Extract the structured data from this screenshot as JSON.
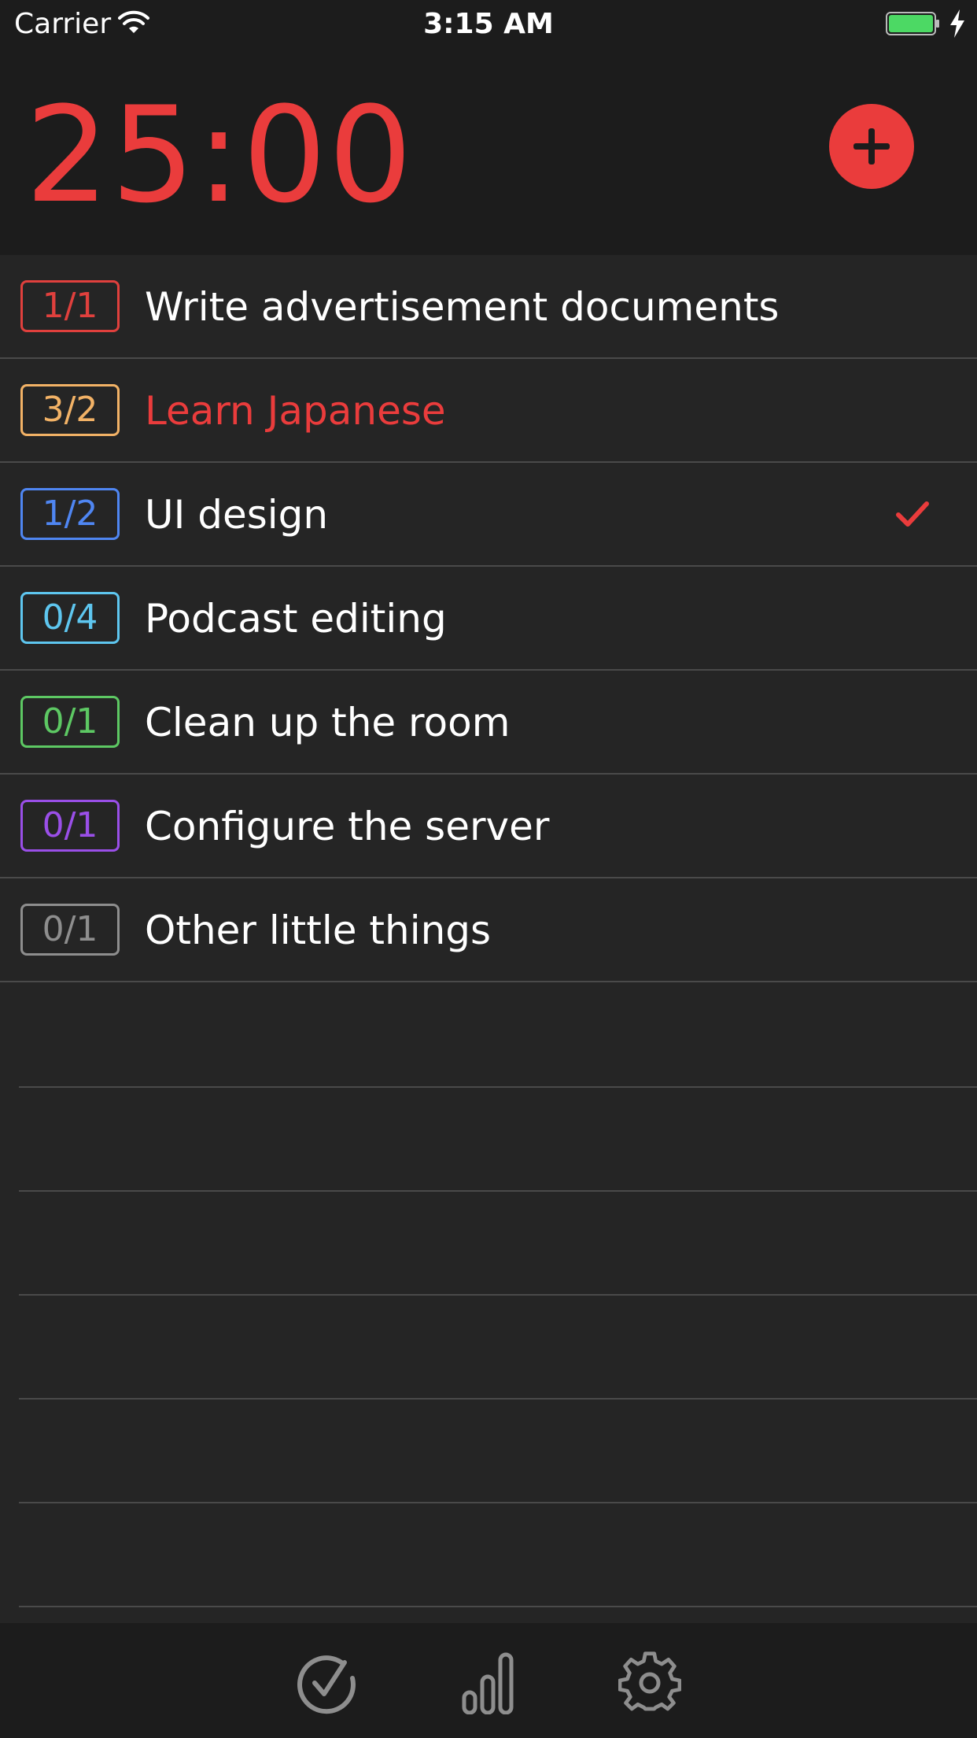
{
  "status_bar": {
    "carrier": "Carrier",
    "time": "3:15 AM",
    "battery_color": "#4cd964"
  },
  "header": {
    "timer": "25:00",
    "accent_color": "#ea3c3c"
  },
  "tasks": [
    {
      "count": "1/1",
      "title": "Write advertisement documents",
      "color": "#e0403d",
      "title_color": "#ffffff",
      "checked": false
    },
    {
      "count": "3/2",
      "title": "Learn Japanese",
      "color": "#f2b266",
      "title_color": "#ea3c3c",
      "checked": false
    },
    {
      "count": "1/2",
      "title": "UI design",
      "color": "#4f86f2",
      "title_color": "#ffffff",
      "checked": true
    },
    {
      "count": "0/4",
      "title": "Podcast editing",
      "color": "#5ec6ef",
      "title_color": "#ffffff",
      "checked": false
    },
    {
      "count": "0/1",
      "title": "Clean up the room",
      "color": "#5dc863",
      "title_color": "#ffffff",
      "checked": false
    },
    {
      "count": "0/1",
      "title": "Configure the server",
      "color": "#9a4fe8",
      "title_color": "#ffffff",
      "checked": false
    },
    {
      "count": "0/1",
      "title": "Other little things",
      "color": "#8e8e8e",
      "title_color": "#ffffff",
      "checked": false
    }
  ],
  "tabbar": {
    "icons": [
      "tasks-check-icon",
      "statistics-icon",
      "settings-gear-icon"
    ],
    "icon_color": "#8e8e8e"
  }
}
